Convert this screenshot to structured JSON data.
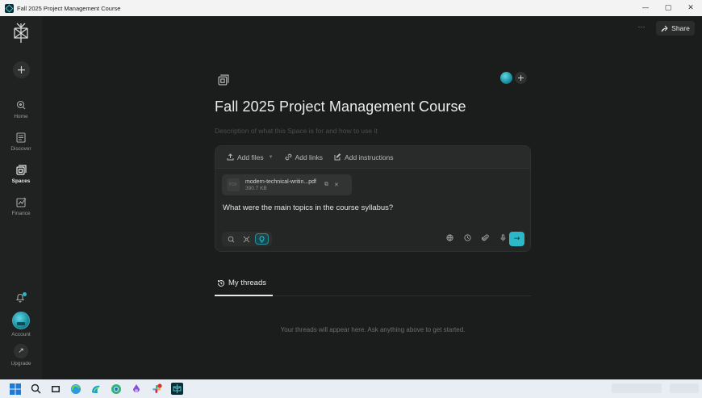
{
  "window": {
    "title": "Fall 2025 Project Management Course",
    "controls": [
      "—",
      "▢",
      "✕"
    ]
  },
  "sidebar": {
    "new_label": "+",
    "items": [
      {
        "label": "Home",
        "icon": "home-search-icon"
      },
      {
        "label": "Discover",
        "icon": "newspaper-icon"
      },
      {
        "label": "Spaces",
        "icon": "spaces-icon"
      },
      {
        "label": "Finance",
        "icon": "chart-icon"
      }
    ],
    "account_label": "Account",
    "upgrade_label": "Upgrade",
    "upgrade_glyph": "↗"
  },
  "header": {
    "more_label": "···",
    "share_label": "Share"
  },
  "space": {
    "title": "Fall 2025 Project Management Course",
    "description_placeholder": "Description of what this Space is for and how to use it",
    "add_member_label": "+"
  },
  "toolbar": {
    "add_files": "Add files",
    "add_links": "Add links",
    "add_instructions": "Add instructions"
  },
  "file": {
    "type": "PDF",
    "name": "modern-technical-writin...pdf",
    "size": "390.7 KB"
  },
  "query": {
    "text": "What were the main topics in the course syllabus?"
  },
  "submit_glyph": "→",
  "threads": {
    "tab_label": "My threads",
    "empty_message": "Your threads will appear here. Ask anything above to get started."
  },
  "colors": {
    "accent": "#2bb8c9",
    "background": "#1b1c1c",
    "sidebar": "#202222",
    "panel": "#242626"
  }
}
